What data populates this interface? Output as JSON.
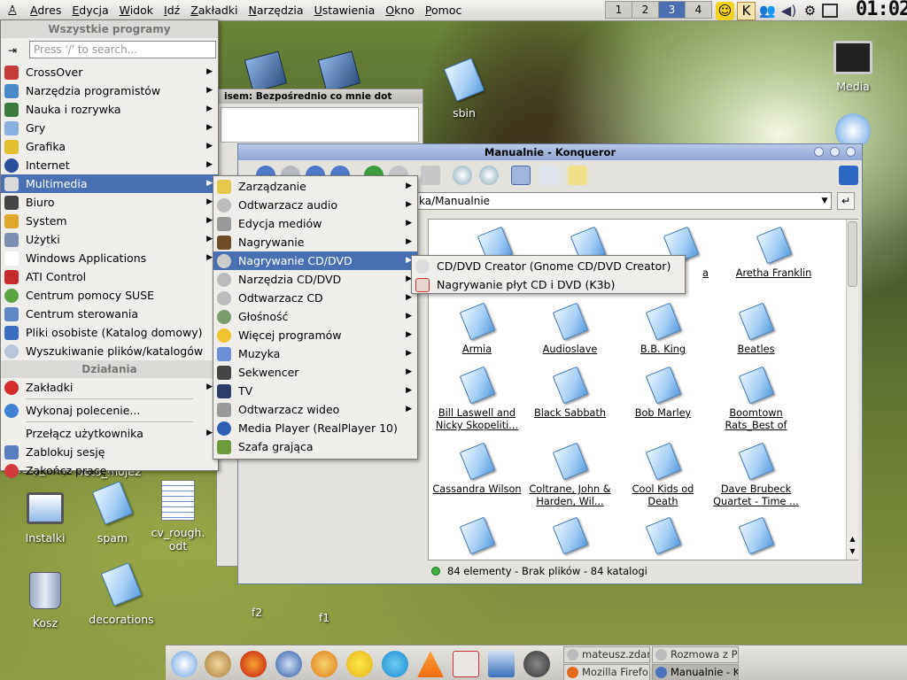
{
  "top_panel": {
    "kmenu_glyph": "♙",
    "menus": [
      "Adres",
      "Edycja",
      "Widok",
      "Idź",
      "Zakładki",
      "Narzędzia",
      "Ustawienia",
      "Okno",
      "Pomoc"
    ],
    "desktops": [
      "1",
      "2",
      "3",
      "4"
    ],
    "clock": "01:02"
  },
  "desktop_icons": {
    "media": "Media",
    "sbin": "sbin",
    "install": "Instalki",
    "spam": "spam",
    "cv": "cv_rough.\nodt",
    "trash": "Kosz",
    "decorations": "decorations",
    "f2": "f2",
    "f1": "f1",
    "foty": "foty_moje",
    "foto2": "foto_moje2"
  },
  "back_window": {
    "title": "isem: Bezpośrednio co mnie dot"
  },
  "konqueror": {
    "title": "Manualnie - Konqueror",
    "location": "ka/Manualnie",
    "status": "84 elementy - Brak plików - 84 katalogi",
    "folders": [
      "a",
      "Aretha Franklin",
      "Armia",
      "Audioslave",
      "B.B. King",
      "Beatles",
      "Bill Laswell and Nicky Skopeliti...",
      "Black Sabbath",
      "Bob Marley",
      "Boomtown Rats_Best of",
      "Cassandra Wilson",
      "Coltrane, John & Harden, Wil...",
      "Cool Kids od Death",
      "Dave Brubeck Quartet - Time ..."
    ]
  },
  "kmenu": {
    "header_all": "Wszystkie programy",
    "search_placeholder": "Press '/' to search...",
    "categories": [
      "CrossOver",
      "Narzędzia programistów",
      "Nauka i rozrywka",
      "Gry",
      "Grafika",
      "Internet",
      "Multimedia",
      "Biuro",
      "System",
      "Użytki",
      "Windows Applications",
      "ATI Control",
      "Centrum pomocy SUSE",
      "Centrum sterowania",
      "Pliki osobiste (Katalog domowy)",
      "Wyszukiwanie plików/katalogów"
    ],
    "header_actions": "Działania",
    "actions": [
      "Zakładki",
      "Wykonaj polecenie...",
      "Przełącz użytkownika",
      "Zablokuj sesję",
      "Zakończ pracę..."
    ]
  },
  "multimedia_menu": [
    "Zarządzanie",
    "Odtwarzacz audio",
    "Edycja mediów",
    "Nagrywanie",
    "Nagrywanie CD/DVD",
    "Narzędzia CD/DVD",
    "Odtwarzacz CD",
    "Głośność",
    "Więcej programów",
    "Muzyka",
    "Sekwencer",
    "TV",
    "Odtwarzacz wideo",
    "Media Player (RealPlayer 10)",
    "Szafa grająca"
  ],
  "cd_menu": [
    "CD/DVD Creator (Gnome CD/DVD Creator)",
    "Nagrywanie płyt CD i DVD (K3b)"
  ],
  "taskbar": {
    "tasks": [
      "mateusz.zdar",
      "Rozmowa z P",
      "Mozilla Firefo",
      "Manualnie - K"
    ]
  },
  "colors": {
    "selection": "#4a70b4",
    "panel": "#e8e6e1"
  }
}
